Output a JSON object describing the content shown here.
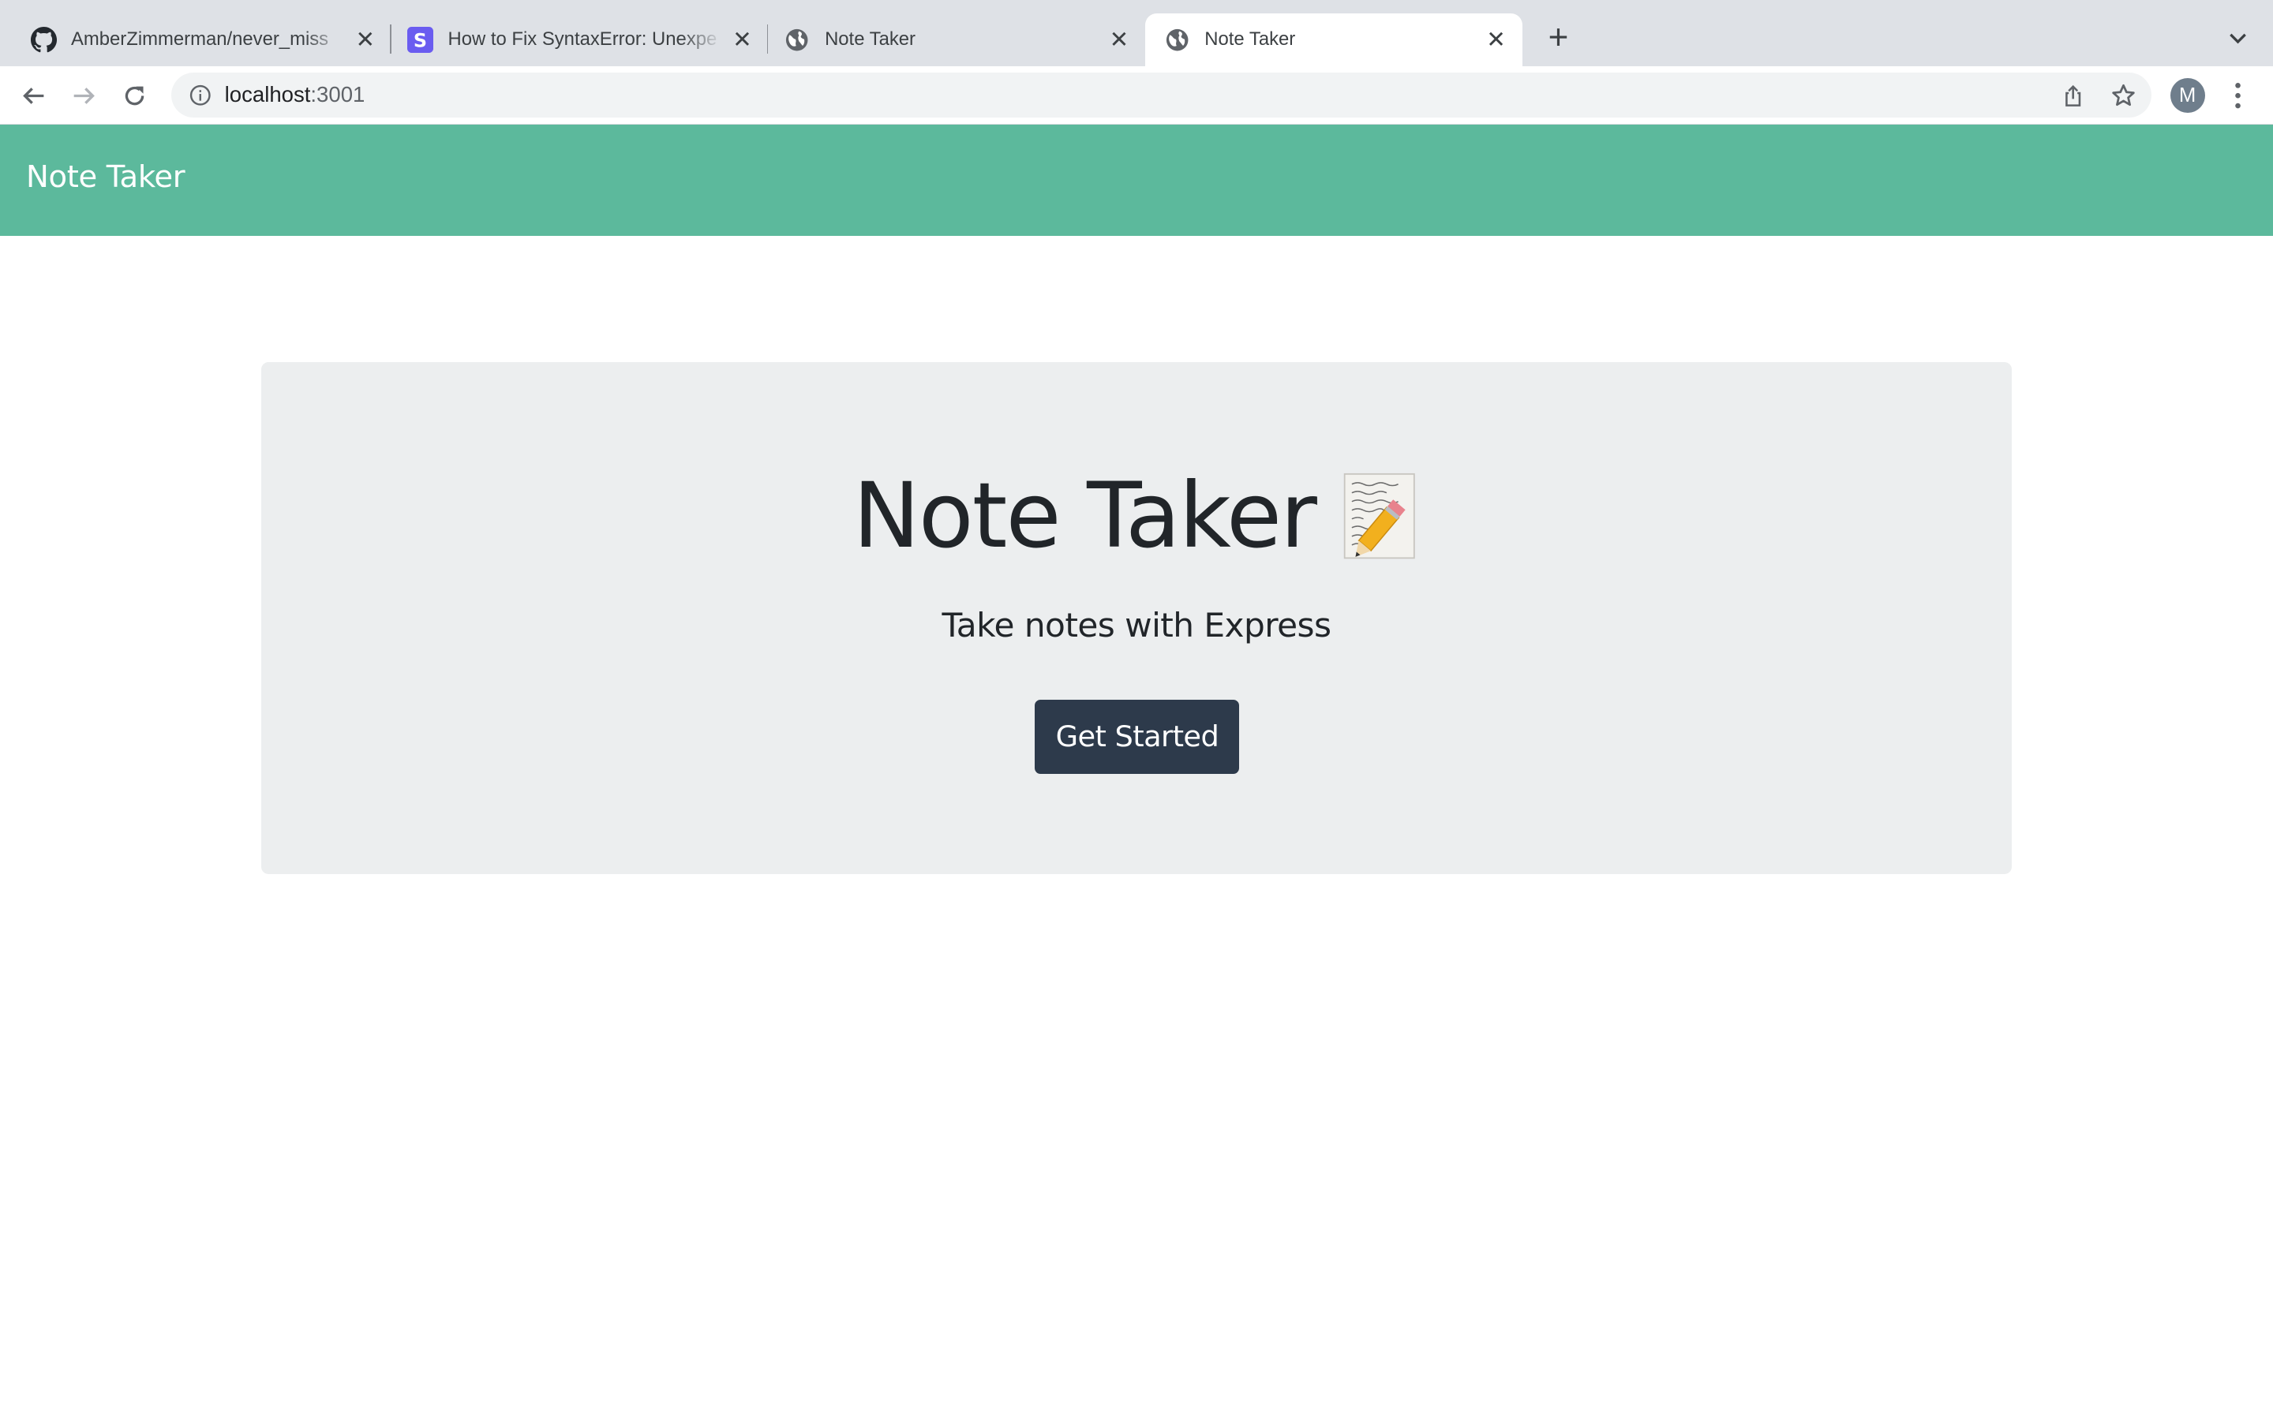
{
  "browser": {
    "tabs": [
      {
        "title": "AmberZimmerman/never_miss",
        "icon": "github-icon",
        "active": false
      },
      {
        "title": "How to Fix SyntaxError: Unexpe",
        "icon": "s-logo-icon",
        "active": false
      },
      {
        "title": "Note Taker",
        "icon": "globe-icon",
        "active": false
      },
      {
        "title": "Note Taker",
        "icon": "globe-icon",
        "active": true
      }
    ],
    "address": {
      "host": "localhost",
      "port": ":3001"
    },
    "profile_initial": "M"
  },
  "app": {
    "brand": "Note Taker",
    "hero": {
      "title": "Note Taker",
      "emoji_icon": "memo-icon",
      "subtitle": "Take notes with Express",
      "button_label": "Get Started"
    }
  },
  "colors": {
    "navbar": "#5cb99c",
    "jumbotron": "#eceeef",
    "button": "#2d3a4b"
  }
}
